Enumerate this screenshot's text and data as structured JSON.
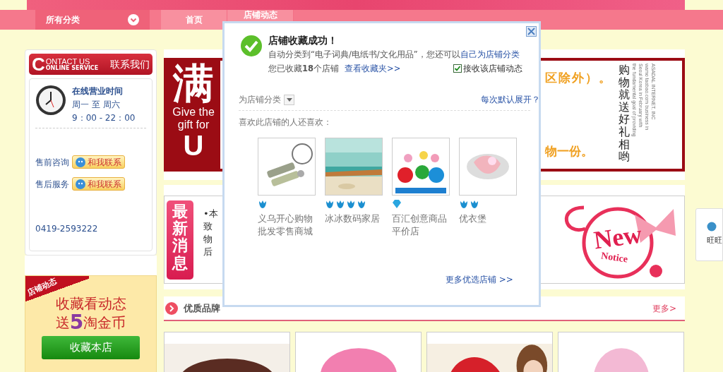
{
  "nav": {
    "items": [
      {
        "label": "所有分类",
        "kind": "category"
      },
      {
        "label": "首页",
        "kind": "link"
      },
      {
        "label": "店铺动态",
        "kind": "link"
      }
    ]
  },
  "contact": {
    "header_initial": "C",
    "header_title": "ONTACT US",
    "header_subtitle": "ONLINE SERVICE",
    "header_label": "联系我们",
    "hours_title": "在线营业时间",
    "days": "周一 至 周六",
    "hours": "9：00 - 22：00",
    "services": [
      {
        "label": "售前咨询",
        "button": "和我联系"
      },
      {
        "label": "售后服务",
        "button": "和我联系"
      }
    ],
    "phone": "0419-2593222"
  },
  "promo": {
    "ribbon": "店铺动态",
    "line1": "收藏看动态",
    "line2_prefix": "送",
    "line2_number": "5",
    "line2_suffix": "淘金币",
    "button": "收藏本店"
  },
  "banner": {
    "big_char": "满",
    "caption": "Give the gift for",
    "big_letter": "U",
    "line1": "区除外）。",
    "line2": "物一份。",
    "vertical_text": "购物就送好礼相哟",
    "fine_print": [
      "ASADAL INTERNET, INC",
      "wamo taobao.com business in",
      "Seoul Korea in February with",
      "the fundamental goal of providing"
    ]
  },
  "news": {
    "badge": "最新消息",
    "lines": [
      "•本",
      "致",
      "物",
      "后"
    ],
    "notice_word": "New",
    "notice_sub": "Notice"
  },
  "brands": {
    "title": "优质品牌",
    "more": "更多>"
  },
  "side_widget": {
    "label": "旺旺"
  },
  "modal": {
    "title": "店铺收藏成功！",
    "message": "自动分类到“电子词典/电纸书/文化用品”，您还可以",
    "message_link": "自己为店铺分类",
    "count": "您已收藏**18**个店铺",
    "count_link": "查看收藏夹>>",
    "subscribe": {
      "label": "接收该店铺动态",
      "checked": true
    },
    "category_label": "为店铺分类",
    "expand_link": "每次默认展开？",
    "also_like": "喜欢此店铺的人还喜欢：",
    "shops": [
      {
        "name": "义乌开心购物批发零售商城",
        "badges": [
          {
            "kind": "crown"
          }
        ]
      },
      {
        "name": "冰冰数码家居",
        "badges": [
          {
            "kind": "crown"
          },
          {
            "kind": "crown"
          },
          {
            "kind": "crown"
          },
          {
            "kind": "crown"
          }
        ]
      },
      {
        "name": "百汇创意商品平价店",
        "badges": [
          {
            "kind": "diamond"
          }
        ]
      },
      {
        "name": "优衣堡",
        "badges": [
          {
            "kind": "crown"
          },
          {
            "kind": "crown"
          }
        ]
      }
    ],
    "more": "更多优选店铺 >>"
  }
}
